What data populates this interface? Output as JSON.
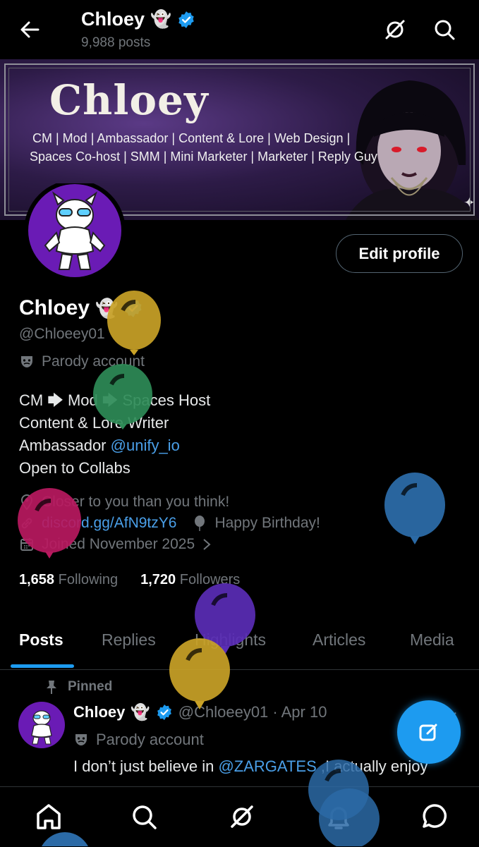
{
  "header": {
    "name": "Chloey",
    "name_emoji": "👻",
    "post_count": "9,988 posts"
  },
  "banner": {
    "title": "Chloey",
    "line1": "CM | Mod | Ambassador | Content & Lore | Web Design |",
    "line2": "Spaces Co-host | SMM | Mini Marketer | Marketer | Reply Guy"
  },
  "actions": {
    "edit_profile": "Edit profile"
  },
  "profile": {
    "name": "Chloey",
    "name_emoji": "👻",
    "handle": "@Chloeey01",
    "parody_label": "Parody account",
    "bio": {
      "line1_a": "CM",
      "line1_b": "Mod",
      "line1_c": "Spaces Host",
      "line2": "Content & Lore Writer",
      "line3_prefix": "Ambassador",
      "line3_link": "@unify_io",
      "line4": "Open to Collabs"
    },
    "location": "Closer to you than you think!",
    "website": "discord.gg/AfN9tzY6",
    "birthday": "Happy Birthday!",
    "joined": "Joined November 2025",
    "following_count": "1,658",
    "following_label": "Following",
    "followers_count": "1,720",
    "followers_label": "Followers"
  },
  "tabs": [
    {
      "label": "Posts",
      "active": true
    },
    {
      "label": "Replies",
      "active": false
    },
    {
      "label": "Highlights",
      "active": false
    },
    {
      "label": "Articles",
      "active": false
    },
    {
      "label": "Media",
      "active": false
    }
  ],
  "pinned_post": {
    "pinned_label": "Pinned",
    "author": "Chloey",
    "author_emoji": "👻",
    "handle_date": "@Chloeey01 · Apr 10",
    "parody_label": "Parody account",
    "text_prefix": "I don’t just believe in ",
    "text_mention": "@ZARGATES",
    "text_suffix": " ,I actually enjoy"
  },
  "icons": {
    "back": "arrow-left-icon",
    "grok": "grok-icon",
    "search": "search-icon",
    "verified": "verified-badge-icon",
    "parody": "theater-mask-icon",
    "location": "location-pin-icon",
    "link": "link-icon",
    "birthday": "balloon-icon",
    "calendar": "calendar-icon",
    "pin": "pin-icon",
    "compose": "compose-icon",
    "nav": [
      "home-icon",
      "search-icon",
      "grok-icon",
      "notifications-icon",
      "messages-icon"
    ]
  },
  "colors": {
    "accent": "#1d9bf0",
    "background": "#000000",
    "muted": "#71767b",
    "balloon_yellow": "#c9a227",
    "balloon_green": "#2e8b57",
    "balloon_pink": "#b8195f",
    "balloon_blue": "#2b6aa6",
    "balloon_purple": "#5a2db6"
  }
}
